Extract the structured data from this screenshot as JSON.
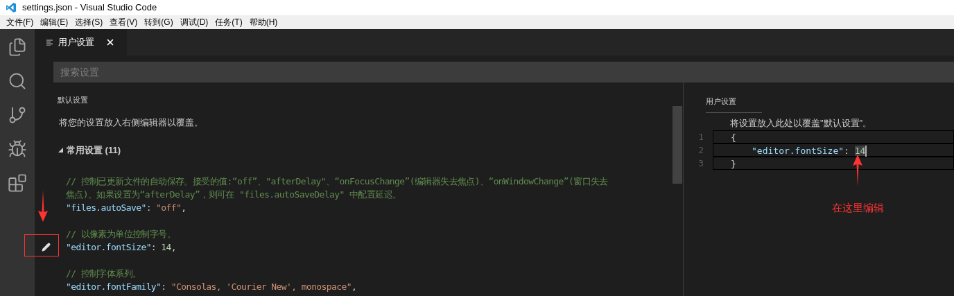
{
  "window": {
    "title": "settings.json - Visual Studio Code"
  },
  "menu": [
    "文件(F)",
    "编辑(E)",
    "选择(S)",
    "查看(V)",
    "转到(G)",
    "调试(D)",
    "任务(T)",
    "帮助(H)"
  ],
  "activity_bar": [
    {
      "kind": "files"
    },
    {
      "kind": "search"
    },
    {
      "kind": "git"
    },
    {
      "kind": "debug"
    },
    {
      "kind": "extensions"
    }
  ],
  "tabs": [
    {
      "label": "用户设置",
      "selected": true
    }
  ],
  "search": {
    "placeholder": "搜索设置"
  },
  "default_settings": {
    "title": "默认设置",
    "description": "将您的设置放入右侧编辑器以覆盖。",
    "section": {
      "label": "常用设置 (11)",
      "expanded": true
    },
    "lines": [
      {
        "edit_icon": false,
        "tokens": [
          {
            "kind": "comment",
            "text": "// 控制已更新文件的自动保存。接受的值:“off”、\"afterDelay\"、“onFocusChange”(编辑器失去焦点)、“onWindowChange”(窗口失去"
          }
        ]
      },
      {
        "edit_icon": false,
        "tokens": [
          {
            "kind": "comment",
            "text": "焦点)。如果设置为“afterDelay”，则可在 \"files.autoSaveDelay\" 中配置延迟。"
          }
        ]
      },
      {
        "edit_icon": false,
        "tokens": [
          {
            "kind": "key",
            "text": "\"files.autoSave\""
          },
          {
            "kind": "punct",
            "text": ": "
          },
          {
            "kind": "string",
            "text": "\"off\""
          },
          {
            "kind": "punct",
            "text": ","
          }
        ]
      },
      {
        "edit_icon": false
      },
      {
        "edit_icon": false,
        "tokens": [
          {
            "kind": "comment",
            "text": "// 以像素为单位控制字号。"
          }
        ]
      },
      {
        "edit_icon": true,
        "tokens": [
          {
            "kind": "key",
            "text": "\"editor.fontSize\""
          },
          {
            "kind": "punct",
            "text": ": "
          },
          {
            "kind": "number",
            "text": "14"
          },
          {
            "kind": "punct",
            "text": ","
          }
        ]
      },
      {
        "edit_icon": false
      },
      {
        "edit_icon": false,
        "tokens": [
          {
            "kind": "comment",
            "text": "// 控制字体系列。"
          }
        ]
      },
      {
        "edit_icon": false,
        "tokens": [
          {
            "kind": "key",
            "text": "\"editor.fontFamily\""
          },
          {
            "kind": "punct",
            "text": ": "
          },
          {
            "kind": "string",
            "text": "\"Consolas, 'Courier New', monospace\""
          },
          {
            "kind": "punct",
            "text": ","
          }
        ]
      }
    ]
  },
  "user_settings": {
    "title": "用户设置",
    "hint": "将设置放入此处以覆盖\"默认设置\"。",
    "lines": [
      {
        "number": "1",
        "current": false,
        "tokens": [
          {
            "kind": "punct",
            "text": "{"
          }
        ]
      },
      {
        "number": "2",
        "current": true,
        "tokens": [
          {
            "kind": "key",
            "text": "\"editor.fontSize\""
          },
          {
            "kind": "punct",
            "text": ": "
          },
          {
            "kind": "number",
            "text": "14"
          }
        ]
      },
      {
        "number": "3",
        "current": false,
        "tokens": [
          {
            "kind": "punct",
            "text": "}"
          }
        ]
      }
    ]
  },
  "annotation": {
    "label": "在这里编辑"
  }
}
